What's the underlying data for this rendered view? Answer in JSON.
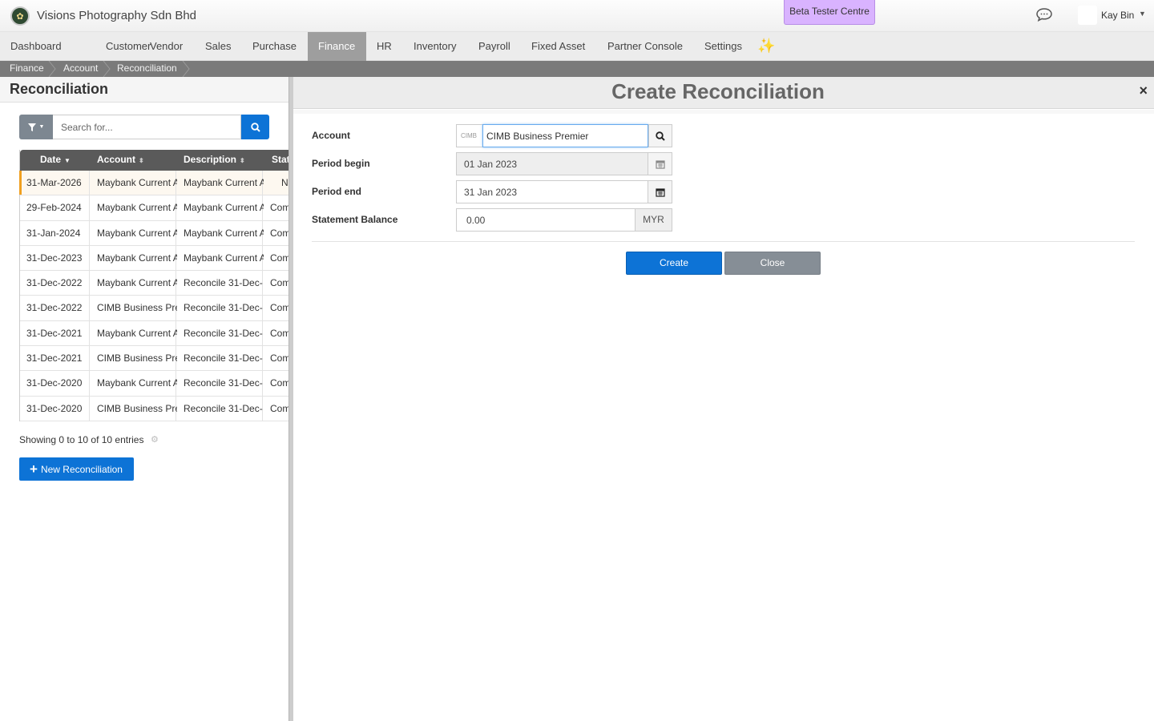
{
  "header": {
    "company": "Visions Photography Sdn Bhd",
    "beta_label": "Beta Tester Centre",
    "user_name": "Kay Bin"
  },
  "nav": {
    "items": [
      "Dashboard",
      "Customer",
      "Vendor",
      "Sales",
      "Purchase",
      "Finance",
      "HR",
      "Inventory",
      "Payroll",
      "Fixed Asset",
      "Partner Console",
      "Settings"
    ],
    "active": "Finance",
    "sparkle": "✨"
  },
  "breadcrumb": [
    "Finance",
    "Account",
    "Reconciliation"
  ],
  "list": {
    "title": "Reconciliation",
    "search_placeholder": "Search for...",
    "columns": [
      "Date",
      "Account",
      "Description",
      "Stat"
    ],
    "rows": [
      {
        "date": "31-Mar-2026",
        "account": "Maybank Current A",
        "description": "Maybank Current A",
        "status": "N"
      },
      {
        "date": "29-Feb-2024",
        "account": "Maybank Current A",
        "description": "Maybank Current A",
        "status": "Com"
      },
      {
        "date": "31-Jan-2024",
        "account": "Maybank Current A",
        "description": "Maybank Current A",
        "status": "Com"
      },
      {
        "date": "31-Dec-2023",
        "account": "Maybank Current A",
        "description": "Maybank Current A",
        "status": "Com"
      },
      {
        "date": "31-Dec-2022",
        "account": "Maybank Current A",
        "description": "Reconcile 31-Dec-",
        "status": "Com"
      },
      {
        "date": "31-Dec-2022",
        "account": "CIMB Business Pre",
        "description": "Reconcile 31-Dec-",
        "status": "Com"
      },
      {
        "date": "31-Dec-2021",
        "account": "Maybank Current A",
        "description": "Reconcile 31-Dec-",
        "status": "Com"
      },
      {
        "date": "31-Dec-2021",
        "account": "CIMB Business Pre",
        "description": "Reconcile 31-Dec-",
        "status": "Com"
      },
      {
        "date": "31-Dec-2020",
        "account": "Maybank Current A",
        "description": "Reconcile 31-Dec-",
        "status": "Com"
      },
      {
        "date": "31-Dec-2020",
        "account": "CIMB Business Pre",
        "description": "Reconcile 31-Dec-",
        "status": "Com"
      }
    ],
    "showing": "Showing 0 to 10 of 10 entries",
    "new_button": "New Reconciliation"
  },
  "modal": {
    "title": "Create Reconciliation",
    "close_x": "×",
    "account_label": "Account",
    "account_prefix": "CIMB",
    "account_value": "CIMB Business Premier",
    "period_begin_label": "Period begin",
    "period_begin_value": "01 Jan 2023",
    "period_end_label": "Period end",
    "period_end_value": "31 Jan 2023",
    "balance_label": "Statement Balance",
    "balance_value": "0.00",
    "balance_unit": "MYR",
    "create_button": "Create",
    "close_button": "Close"
  },
  "colors": {
    "primary": "#0d73d6",
    "nav_active": "#9e9e9e",
    "beta_bg": "#d9b3ff",
    "status_link": "#1a73c9"
  }
}
